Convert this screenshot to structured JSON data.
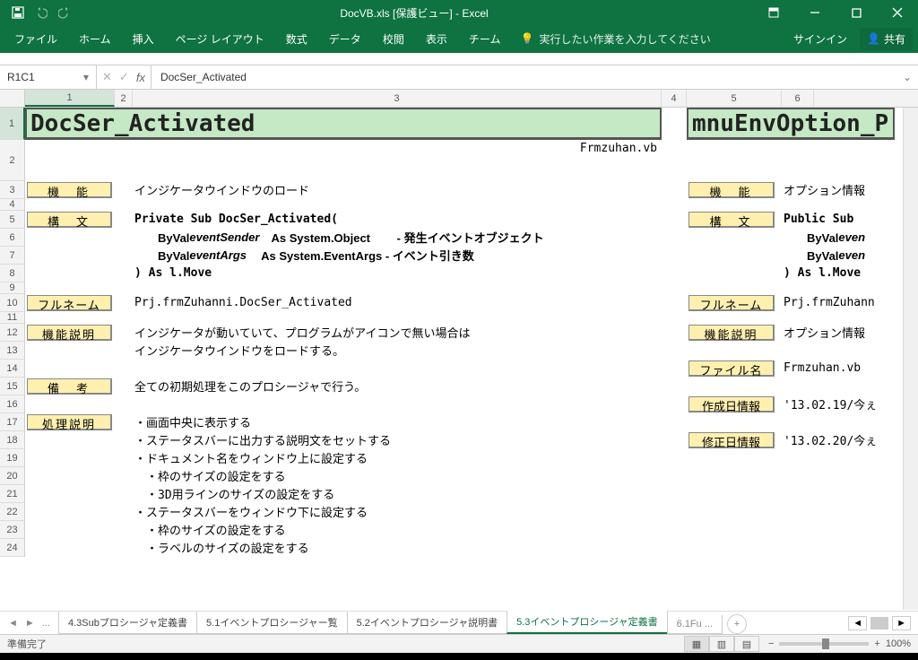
{
  "app": {
    "doc_title": "DocVB.xls  [保護ビュー] - Excel",
    "signin": "サインイン",
    "share": "共有",
    "tell_me": "実行したい作業を入力してください"
  },
  "ribbon": {
    "file": "ファイル",
    "home": "ホーム",
    "insert": "挿入",
    "layout": "ページ レイアウト",
    "formulas": "数式",
    "data": "データ",
    "review": "校閲",
    "view": "表示",
    "team": "チーム"
  },
  "fbar": {
    "cell_ref": "R1C1",
    "formula": "DocSer_Activated"
  },
  "cols": {
    "c1": "1",
    "c2": "2",
    "c3": "3",
    "c4": "4",
    "c5": "5",
    "c6": "6"
  },
  "content": {
    "title_left": "DocSer_Activated",
    "title_right": "mnuEnvOption_P",
    "filename": "Frmzuhan.vb",
    "lab": {
      "func": "機　能",
      "syntax": "構　文",
      "fullname": "フルネーム",
      "funcdesc": "機能説明",
      "remark": "備　考",
      "procdesc": "処理説明",
      "file": "ファイル名",
      "created": "作成日情報",
      "modified": "修正日情報"
    },
    "r3": "インジケータウインドウのロード",
    "r3r": "オプション情報",
    "r5": "Private Sub DocSer_Activated(",
    "r5r": "Public Sub ",
    "r6a": "　　ByVal ",
    "r6i": "eventSender",
    "r6b": "　As System.Object　　 - 発生イベントオブジェクト",
    "r6r": "　　ByVal ",
    "r6ri": "even",
    "r7a": "　　ByVal ",
    "r7i": "eventArgs",
    "r7b": "　 As System.EventArgs - イベント引き数",
    "r7r": "　　ByVal ",
    "r7ri": "even",
    "r8": ") As l.Move",
    "r8r": ") As l.Move",
    "r10": "Prj.frmZuhanni.DocSer_Activated",
    "r10r": "Prj.frmZuhann",
    "r12": "インジケータが動いていて、プログラムがアイコンで無い場合は",
    "r12r": "オプション情報",
    "r13": "インジケータウインドウをロードする。",
    "r14r": "Frmzuhan.vb",
    "r15": "全ての初期処理をこのプロシージャで行う。",
    "r16r": "'13.02.19/今ぇ",
    "r17": "・画面中央に表示する",
    "r18": "・ステータスバーに出力する説明文をセットする",
    "r18r": "'13.02.20/今ぇ",
    "r19": "・ドキュメント名をウィンドウ上に設定する",
    "r20": "　・枠のサイズの設定をする",
    "r21": "　・3D用ラインのサイズの設定をする",
    "r22": "・ステータスバーをウィンドウ下に設定する",
    "r23": "　・枠のサイズの設定をする",
    "r24": "　・ラベルのサイズの設定をする"
  },
  "sheets": {
    "t0": "...",
    "t1": "4.3Subプロシージャ定義書",
    "t2": "5.1イベントプロシージャー覧",
    "t3": "5.2イベントプロシージャ説明書",
    "t4": "5.3イベントプロシージャ定義書",
    "t5": "6.1Fu ...",
    "add": "+"
  },
  "status": {
    "ready": "準備完了",
    "zoom": "100%"
  }
}
